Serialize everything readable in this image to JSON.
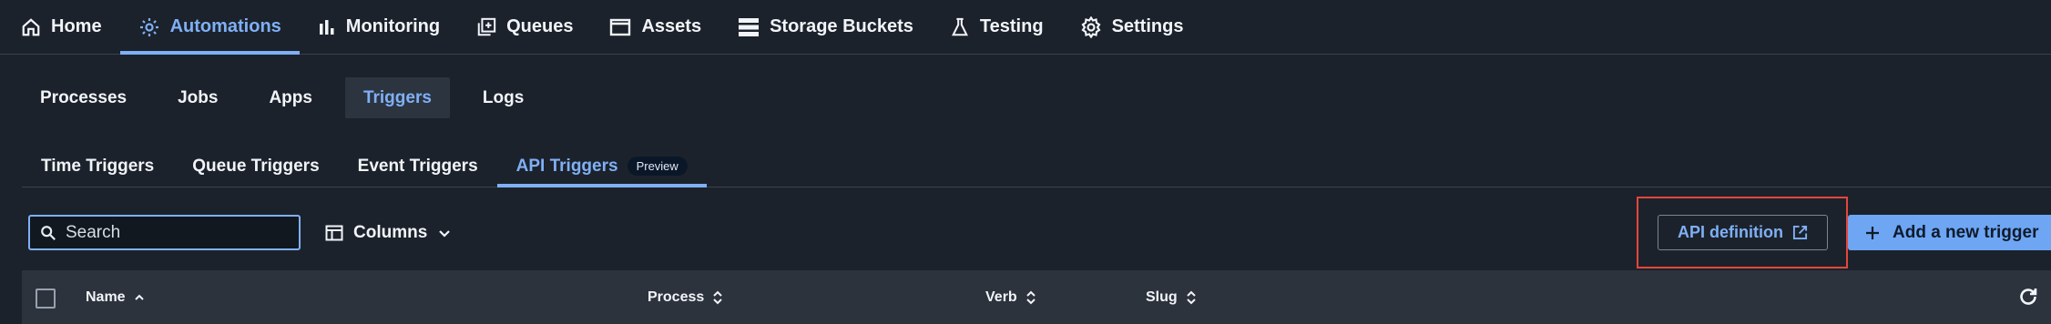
{
  "top_nav": {
    "items": [
      {
        "label": "Home",
        "icon": "home-icon"
      },
      {
        "label": "Automations",
        "icon": "automations-gear-icon",
        "active": true
      },
      {
        "label": "Monitoring",
        "icon": "bar-chart-icon"
      },
      {
        "label": "Queues",
        "icon": "queue-add-icon"
      },
      {
        "label": "Assets",
        "icon": "assets-window-icon"
      },
      {
        "label": "Storage Buckets",
        "icon": "storage-icon"
      },
      {
        "label": "Testing",
        "icon": "flask-icon"
      },
      {
        "label": "Settings",
        "icon": "gear-icon"
      }
    ]
  },
  "sub_nav": {
    "items": [
      {
        "label": "Processes"
      },
      {
        "label": "Jobs"
      },
      {
        "label": "Apps"
      },
      {
        "label": "Triggers",
        "active": true
      },
      {
        "label": "Logs"
      }
    ]
  },
  "trigger_tabs": {
    "items": [
      {
        "label": "Time Triggers"
      },
      {
        "label": "Queue Triggers"
      },
      {
        "label": "Event Triggers"
      },
      {
        "label": "API Triggers",
        "badge": "Preview",
        "active": true
      }
    ]
  },
  "toolbar": {
    "search_placeholder": "Search",
    "columns_label": "Columns",
    "api_definition_label": "API definition",
    "add_trigger_label": "Add a new trigger"
  },
  "table": {
    "columns": [
      {
        "label": "Name",
        "sort": "asc"
      },
      {
        "label": "Process",
        "sort": "none"
      },
      {
        "label": "Verb",
        "sort": "none"
      },
      {
        "label": "Slug",
        "sort": "none"
      }
    ]
  },
  "colors": {
    "background": "#1c222b",
    "accent": "#7fb0f6",
    "primary_button": "#6ea6f4",
    "highlight": "#e3463c",
    "table_header": "#2c333d"
  }
}
